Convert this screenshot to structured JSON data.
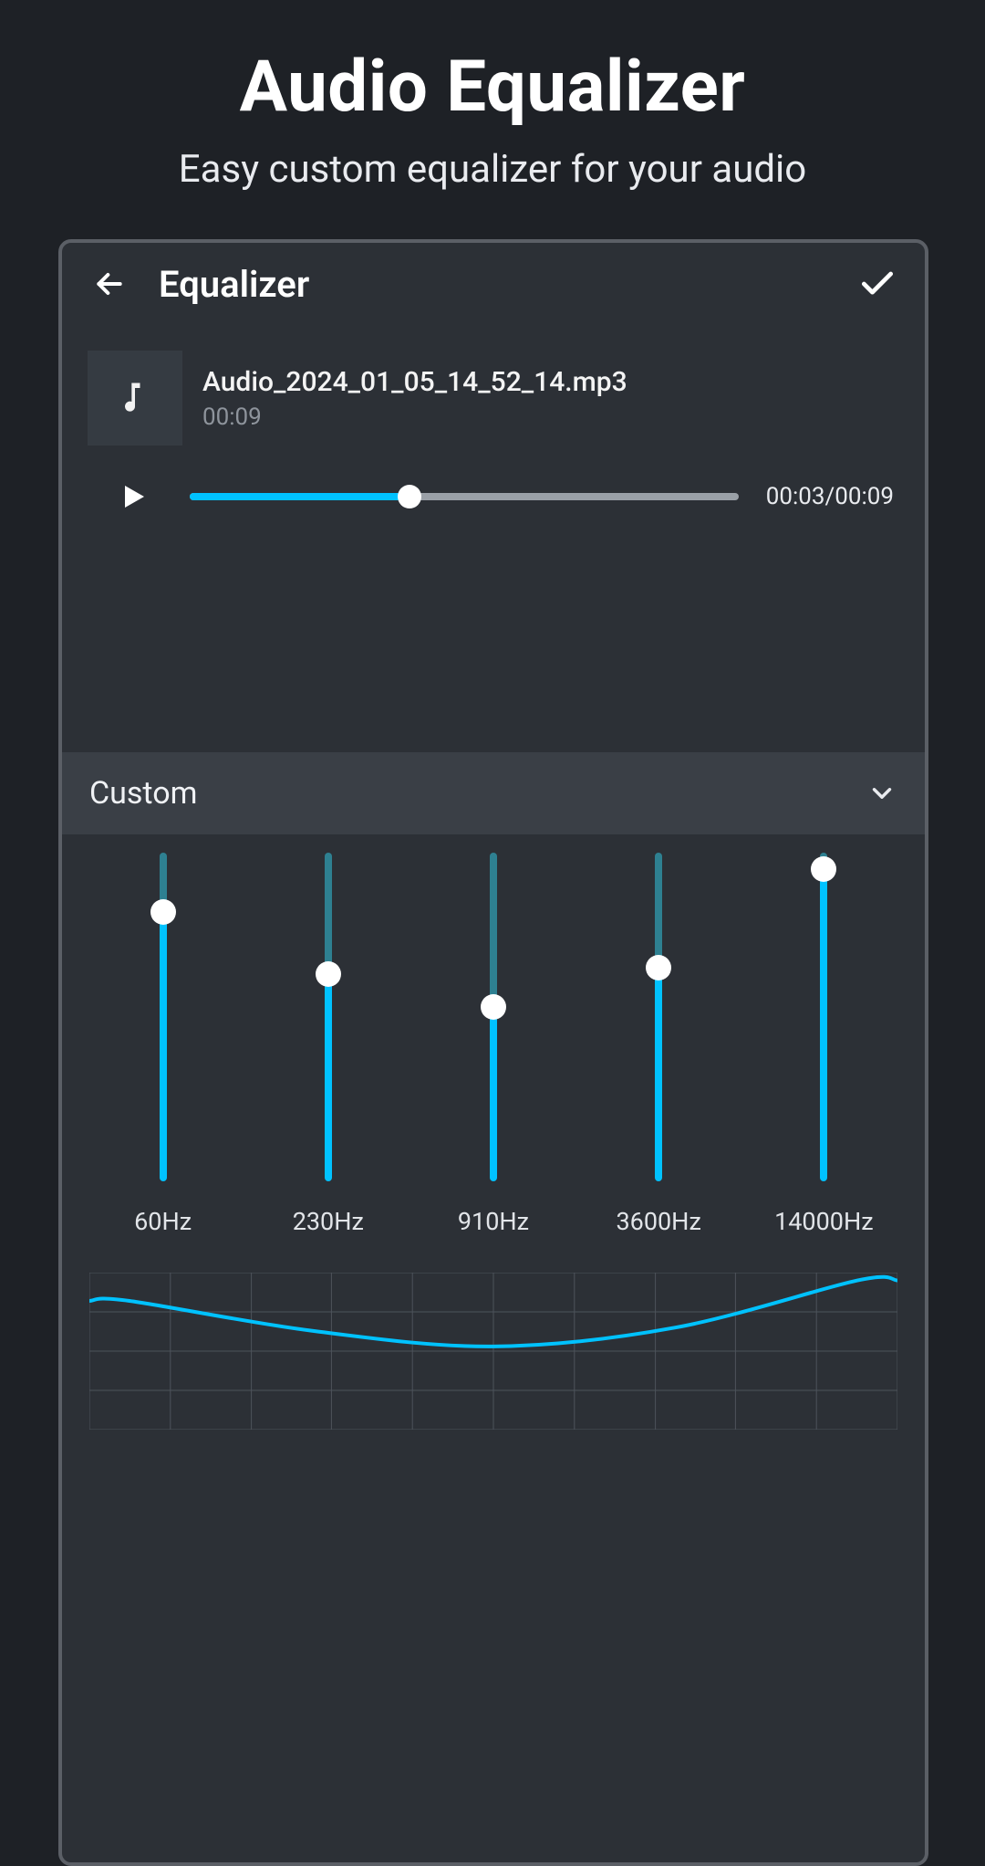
{
  "promo": {
    "title": "Audio Equalizer",
    "subtitle": "Easy custom equalizer for your audio"
  },
  "header": {
    "title": "Equalizer"
  },
  "file": {
    "name": "Audio_2024_01_05_14_52_14.mp3",
    "duration": "00:09"
  },
  "player": {
    "progress_pct": 40,
    "time_label": "00:03/00:09"
  },
  "preset": {
    "selected": "Custom"
  },
  "bands": [
    {
      "freq": "60Hz",
      "value_pct": 82
    },
    {
      "freq": "230Hz",
      "value_pct": 63
    },
    {
      "freq": "910Hz",
      "value_pct": 53
    },
    {
      "freq": "3600Hz",
      "value_pct": 65
    },
    {
      "freq": "14000Hz",
      "value_pct": 95
    }
  ],
  "curve": {
    "points_pct": [
      82,
      63,
      53,
      65,
      95
    ]
  },
  "colors": {
    "accent": "#00c2ff",
    "bg_outer": "#1e2126",
    "bg_device": "#2c3036",
    "bg_preset": "#3a3f46"
  }
}
